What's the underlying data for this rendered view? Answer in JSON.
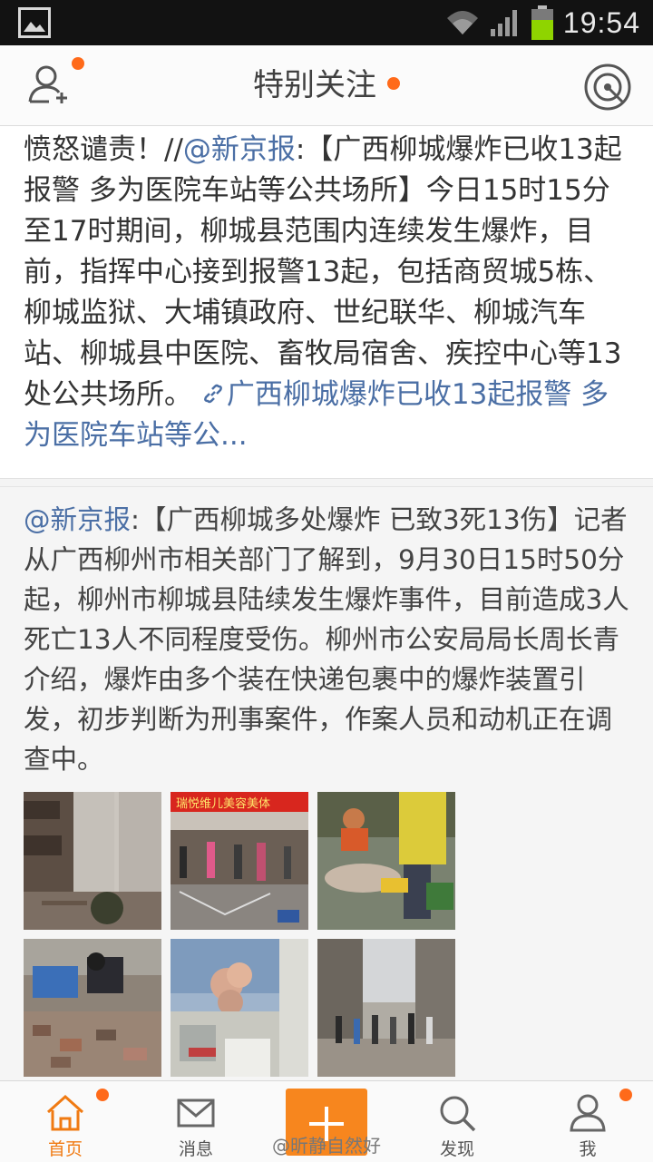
{
  "status_bar": {
    "time": "19:54",
    "icons": [
      "gallery-icon",
      "wifi-icon",
      "signal-icon",
      "battery-icon"
    ]
  },
  "header": {
    "title": "特别关注",
    "left_icon": "add-friend-icon",
    "right_icon": "radar-icon",
    "accent_color": "#ff6a1a"
  },
  "feed": {
    "post1": {
      "text_before": "愤怒谴责！//",
      "mention": "@新京报",
      "text_after": ":【广西柳城爆炸已收13起报警 多为医院车站等公共场所】今日15时15分至17时期间，柳城县范围内连续发生爆炸，目前，指挥中心接到报警13起，包括商贸城5栋、柳城监狱、大埔镇政府、世纪联华、柳城汽车站、柳城县中医院、畜牧局宿舍、疾控中心等13处公共场所。",
      "link_text": "广西柳城爆炸已收13起报警 多为医院车站等公..."
    },
    "post2": {
      "mention": "@新京报",
      "text": ":【广西柳城多处爆炸 已致3死13伤】记者从广西柳州市相关部门了解到，9月30日15时50分起，柳州市柳城县陆续发生爆炸事件，目前造成3人死亡13人不同程度受伤。柳州市公安局局长周长青介绍，爆炸由多个装在快递包裹中的爆炸装置引发，初步判断为刑事案件，作案人员和动机正在调查中。",
      "photo_sign_text": "瑞悦维儿美容美体"
    }
  },
  "tab_bar": {
    "tabs": [
      {
        "label": "首页",
        "icon": "home-icon",
        "active": true
      },
      {
        "label": "消息",
        "icon": "message-icon",
        "active": false
      },
      {
        "label": "",
        "icon": "plus-icon",
        "active": false
      },
      {
        "label": "发现",
        "icon": "discover-icon",
        "active": false
      },
      {
        "label": "我",
        "icon": "profile-icon",
        "active": false
      }
    ],
    "active_color": "#f07a12"
  },
  "watermark": "@昕静自然好"
}
